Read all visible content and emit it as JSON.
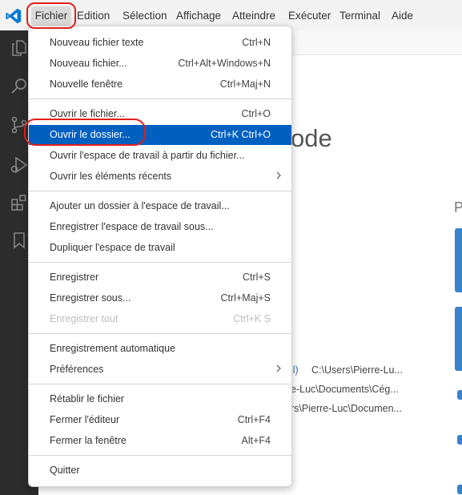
{
  "menubar": {
    "items": [
      "Fichier",
      "Edition",
      "Sélection",
      "Affichage",
      "Atteindre",
      "Exécuter",
      "Terminal",
      "Aide"
    ]
  },
  "activitybar": {
    "icons": [
      "explorer-icon",
      "search-icon",
      "source-control-icon",
      "run-debug-icon",
      "extensions-icon",
      "bookmark-icon"
    ]
  },
  "welcome": {
    "title_fragment": "ode",
    "letter": "P",
    "recent": [
      {
        "left": "il)",
        "right": "C:\\Users\\Pierre-Lu..."
      },
      {
        "left": "e-Luc\\Documents\\Cég...",
        "right": ""
      },
      {
        "left": "rs\\Pierre-Luc\\Documen...",
        "right": ""
      }
    ]
  },
  "file_menu": {
    "items": [
      {
        "label": "Nouveau fichier texte",
        "shortcut": "Ctrl+N"
      },
      {
        "label": "Nouveau fichier...",
        "shortcut": "Ctrl+Alt+Windows+N"
      },
      {
        "label": "Nouvelle fenêtre",
        "shortcut": "Ctrl+Maj+N"
      },
      {
        "label": "Ouvrir le fichier...",
        "shortcut": "Ctrl+O"
      },
      {
        "label": "Ouvrir le dossier...",
        "shortcut": "Ctrl+K Ctrl+O"
      },
      {
        "label": "Ouvrir l'espace de travail à partir du fichier...",
        "shortcut": ""
      },
      {
        "label": "Ouvrir les éléments récents",
        "shortcut": ""
      },
      {
        "label": "Ajouter un dossier à l'espace de travail...",
        "shortcut": ""
      },
      {
        "label": "Enregistrer l'espace de travail sous...",
        "shortcut": ""
      },
      {
        "label": "Dupliquer l'espace de travail",
        "shortcut": ""
      },
      {
        "label": "Enregistrer",
        "shortcut": "Ctrl+S"
      },
      {
        "label": "Enregistrer sous...",
        "shortcut": "Ctrl+Maj+S"
      },
      {
        "label": "Enregistrer tout",
        "shortcut": "Ctrl+K S"
      },
      {
        "label": "Enregistrement automatique",
        "shortcut": ""
      },
      {
        "label": "Préférences",
        "shortcut": ""
      },
      {
        "label": "Rétablir le fichier",
        "shortcut": ""
      },
      {
        "label": "Fermer l'éditeur",
        "shortcut": "Ctrl+F4"
      },
      {
        "label": "Fermer la fenêtre",
        "shortcut": "Alt+F4"
      },
      {
        "label": "Quitter",
        "shortcut": ""
      }
    ]
  },
  "colors": {
    "selection": "#0060c0",
    "annotation": "#e0201a",
    "activitybar": "#2c2c2c",
    "vscode_blue": "#0078d4"
  }
}
